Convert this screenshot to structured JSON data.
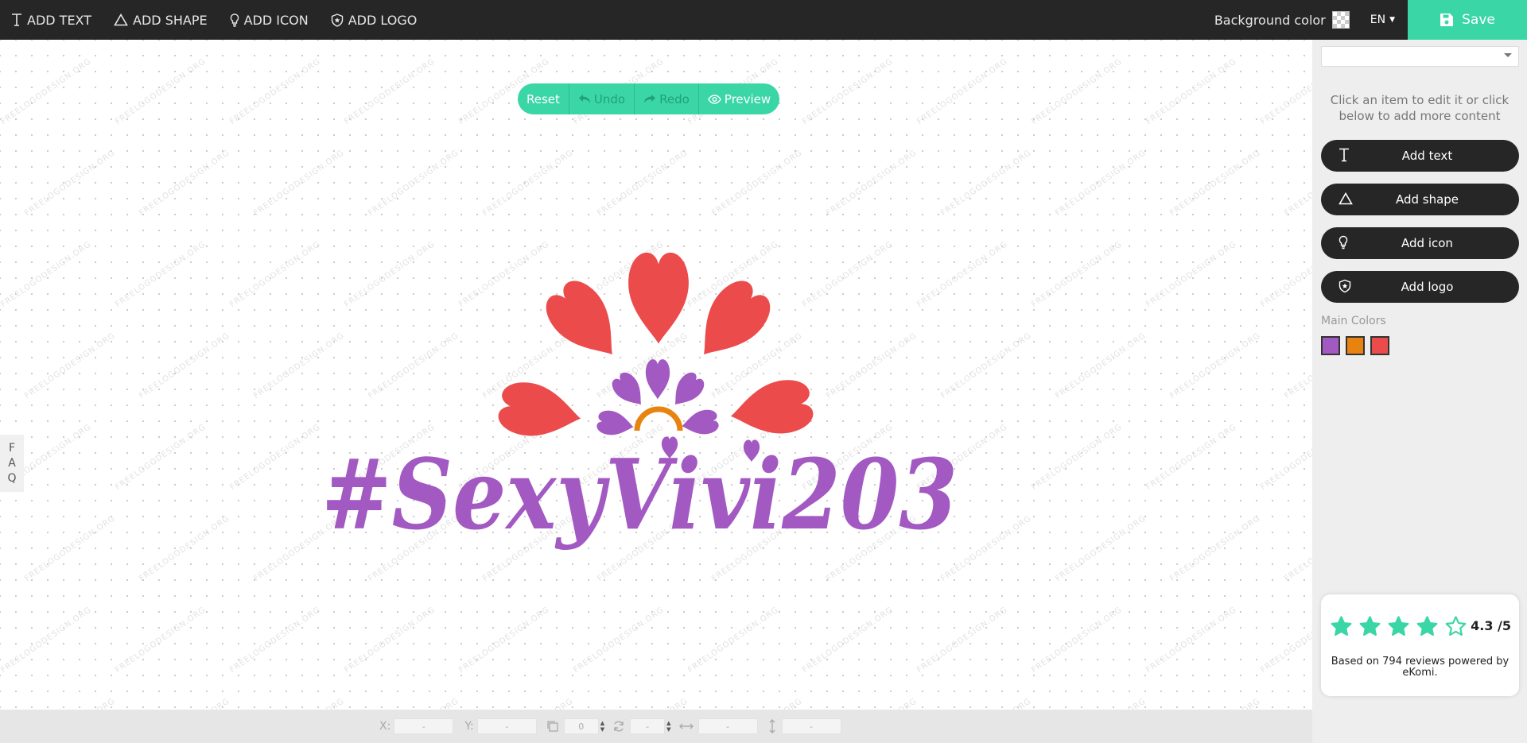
{
  "toolbar": {
    "items": [
      {
        "label": "ADD TEXT",
        "icon": "text-icon"
      },
      {
        "label": "ADD SHAPE",
        "icon": "triangle-icon"
      },
      {
        "label": "ADD ICON",
        "icon": "lightbulb-icon"
      },
      {
        "label": "ADD LOGO",
        "icon": "shield-icon"
      }
    ],
    "background_color_label": "Background color",
    "language": "EN",
    "save_label": "Save"
  },
  "canvas": {
    "actions": {
      "reset": "Reset",
      "undo": "Undo",
      "redo": "Redo",
      "preview": "Preview"
    },
    "faq": [
      "F",
      "A",
      "Q"
    ],
    "watermark": "FREELOGODESIGN.ORG",
    "logo": {
      "text": "#SexyVivi203",
      "colors": {
        "petal_red": "#ec4b4c",
        "petal_purple": "#a259c2",
        "arc_orange": "#e9830f",
        "text_purple": "#a259c2"
      }
    }
  },
  "bottombar": {
    "x_label": "X:",
    "x_value": "-",
    "y_label": "Y:",
    "y_value": "-",
    "layer_value": "0",
    "rotation_value": "-",
    "width_value": "-",
    "height_value": "-"
  },
  "panel": {
    "hint": "Click an item to edit it or click below to add more content",
    "buttons": [
      "Add text",
      "Add shape",
      "Add icon",
      "Add logo"
    ],
    "main_colors_title": "Main Colors",
    "main_colors": [
      "#a259c2",
      "#e9830f",
      "#ec4b4c"
    ],
    "reviews": {
      "score": "4.3 /5",
      "rating": 4.3,
      "text": "Based on 794 reviews powered by eKomi."
    }
  },
  "colors": {
    "accent": "#3ad6a6",
    "topbar": "#262626"
  }
}
